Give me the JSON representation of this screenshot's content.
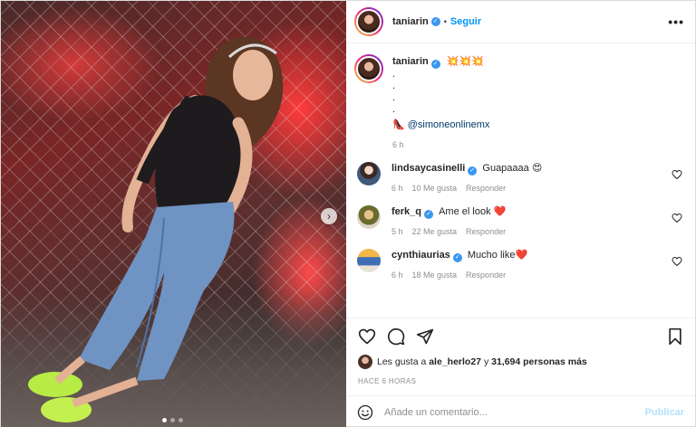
{
  "header": {
    "username": "taniarin",
    "separator": "•",
    "follow_label": "Seguir",
    "more_label": "•••"
  },
  "caption": {
    "username": "taniarin",
    "text": "💥💥💥",
    "dots": [
      ".",
      ".",
      ".",
      "."
    ],
    "mention_prefix": "👠",
    "mention": "@simoneonlinemx",
    "time": "6 h"
  },
  "comments": [
    {
      "username": "lindsaycasinelli",
      "text": "Guapaaaa 😍",
      "time": "6 h",
      "likes": "10 Me gusta",
      "reply": "Responder"
    },
    {
      "username": "ferk_q",
      "text": "Ame el look ❤️",
      "time": "5 h",
      "likes": "22 Me gusta",
      "reply": "Responder"
    },
    {
      "username": "cynthiaurias",
      "text": "Mucho like❤️",
      "time": "6 h",
      "likes": "18 Me gusta",
      "reply": "Responder"
    }
  ],
  "likes_line": {
    "prefix": "Les gusta a",
    "user": "ale_herlo27",
    "middle": "y",
    "count": "31,694 personas más"
  },
  "posted_ago": "HACE 6 HORAS",
  "comment_box": {
    "placeholder": "Añade un comentario...",
    "publish_label": "Publicar"
  },
  "colors": {
    "accent": "#0095f6",
    "verified": "#3897f0",
    "publish_disabled": "#b2dffc",
    "muted": "#8e8e8e"
  },
  "carousel": {
    "current": 1,
    "total": 3
  }
}
